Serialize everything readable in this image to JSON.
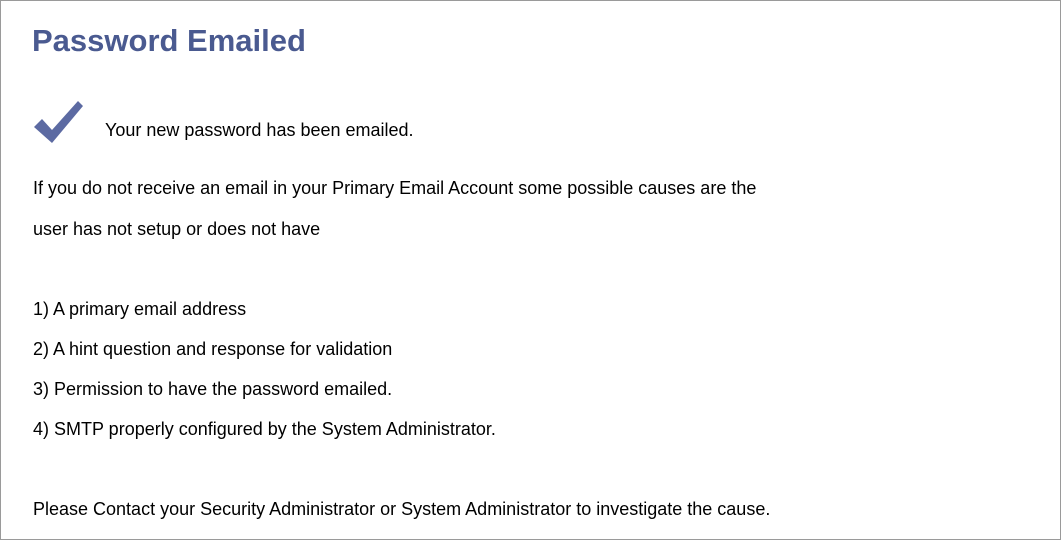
{
  "page": {
    "title": "Password Emailed"
  },
  "confirmation": {
    "icon": "checkmark-icon",
    "icon_color": "#5c6aa2",
    "message": "Your new password has been emailed."
  },
  "explanation": {
    "line1": "If you do not receive an email in your Primary Email Account some possible causes are the",
    "line2": "user has not setup or does not have"
  },
  "causes": [
    "1) A primary email address",
    "2) A hint question and response for validation",
    "3) Permission to have the password emailed.",
    "4) SMTP properly configured by the System Administrator."
  ],
  "footer": {
    "message": "Please Contact your Security Administrator or System Administrator to investigate the cause."
  },
  "colors": {
    "title": "#4a5a90",
    "border": "#9a9a9a"
  }
}
